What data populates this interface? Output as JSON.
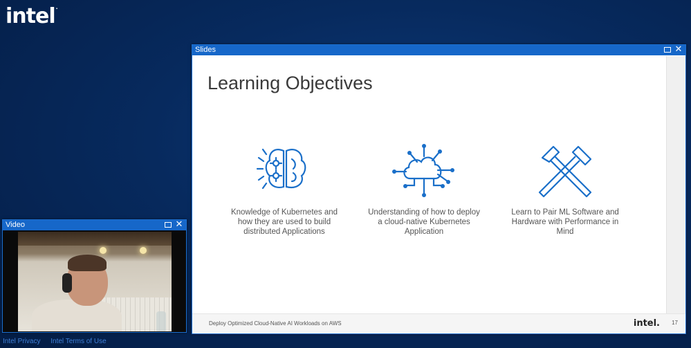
{
  "brand": {
    "logo": "intel",
    "reg": "."
  },
  "slides_window": {
    "title": "Slides",
    "slide": {
      "title": "Learning Objectives",
      "objectives": [
        {
          "icon": "brain-gears-icon",
          "text": "Knowledge of Kubernetes and how they are used to build distributed Applications"
        },
        {
          "icon": "cloud-network-icon",
          "text": "Understanding of how to deploy a cloud-native Kubernetes Application"
        },
        {
          "icon": "hammers-icon",
          "text": "Learn to Pair ML Software and Hardware with Performance in Mind"
        }
      ],
      "footer_text": "Deploy Optimized Cloud-Native AI Workloads on AWS",
      "footer_logo": "intel.",
      "page_number": "17"
    }
  },
  "video_window": {
    "title": "Video"
  },
  "links": [
    "Intel Privacy",
    "Intel Terms of Use"
  ],
  "colors": {
    "accent": "#1667c9",
    "icon_blue": "#1a6fc9"
  }
}
